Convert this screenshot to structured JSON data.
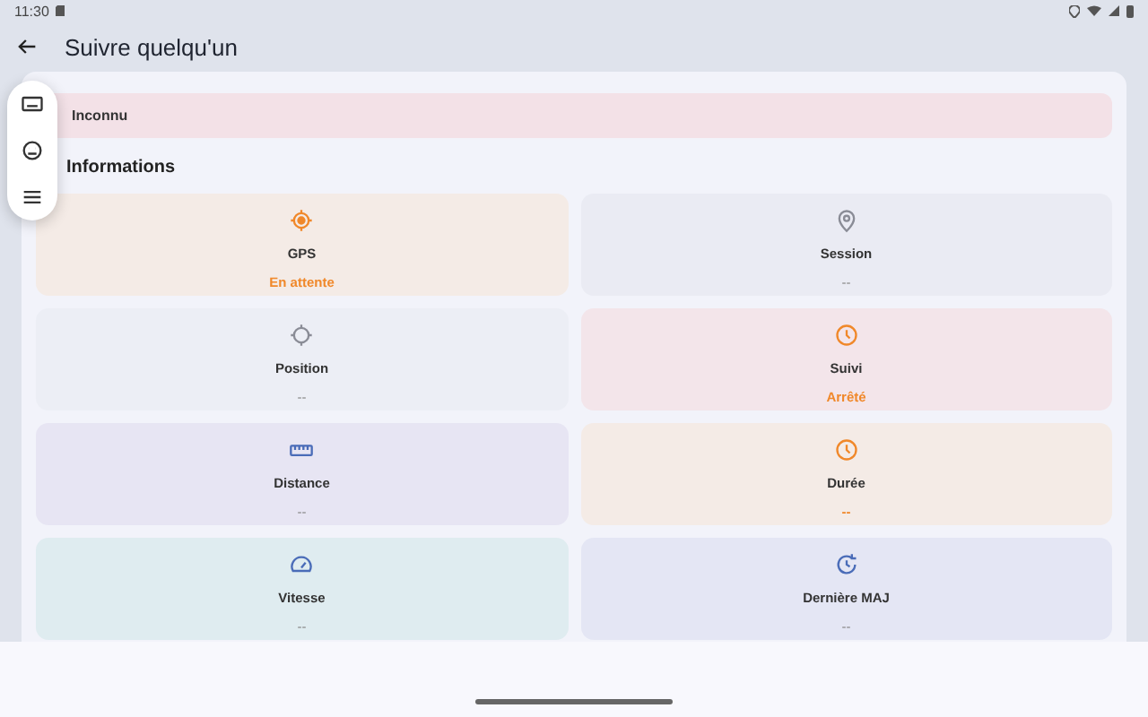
{
  "status_bar": {
    "time": "11:30"
  },
  "app_bar": {
    "title": "Suivre quelqu'un"
  },
  "banner": {
    "text": "Inconnu"
  },
  "section": {
    "title": "Informations"
  },
  "cards": [
    {
      "kind": "gps",
      "label": "GPS",
      "value": "En attente",
      "color": "#f4ebe6",
      "highlight": true
    },
    {
      "kind": "pin",
      "label": "Session",
      "value": "--",
      "color": "#eaebf3",
      "highlight": false
    },
    {
      "kind": "crosshair",
      "label": "Position",
      "value": "--",
      "color": "#eceef5",
      "highlight": false
    },
    {
      "kind": "clock",
      "label": "Suivi",
      "value": "Arrêté",
      "color": "#f3e5ea",
      "highlight": true
    },
    {
      "kind": "ruler",
      "label": "Distance",
      "value": "--",
      "color": "#e7e5f3",
      "highlight": false
    },
    {
      "kind": "clock",
      "label": "Durée",
      "value": "--",
      "color": "#f4ebe6",
      "highlight": true
    },
    {
      "kind": "gauge",
      "label": "Vitesse",
      "value": "--",
      "color": "#dfecf0",
      "highlight": false
    },
    {
      "kind": "refresh",
      "label": "Dernière MAJ",
      "value": "--",
      "color": "#e4e6f4",
      "highlight": false
    }
  ]
}
